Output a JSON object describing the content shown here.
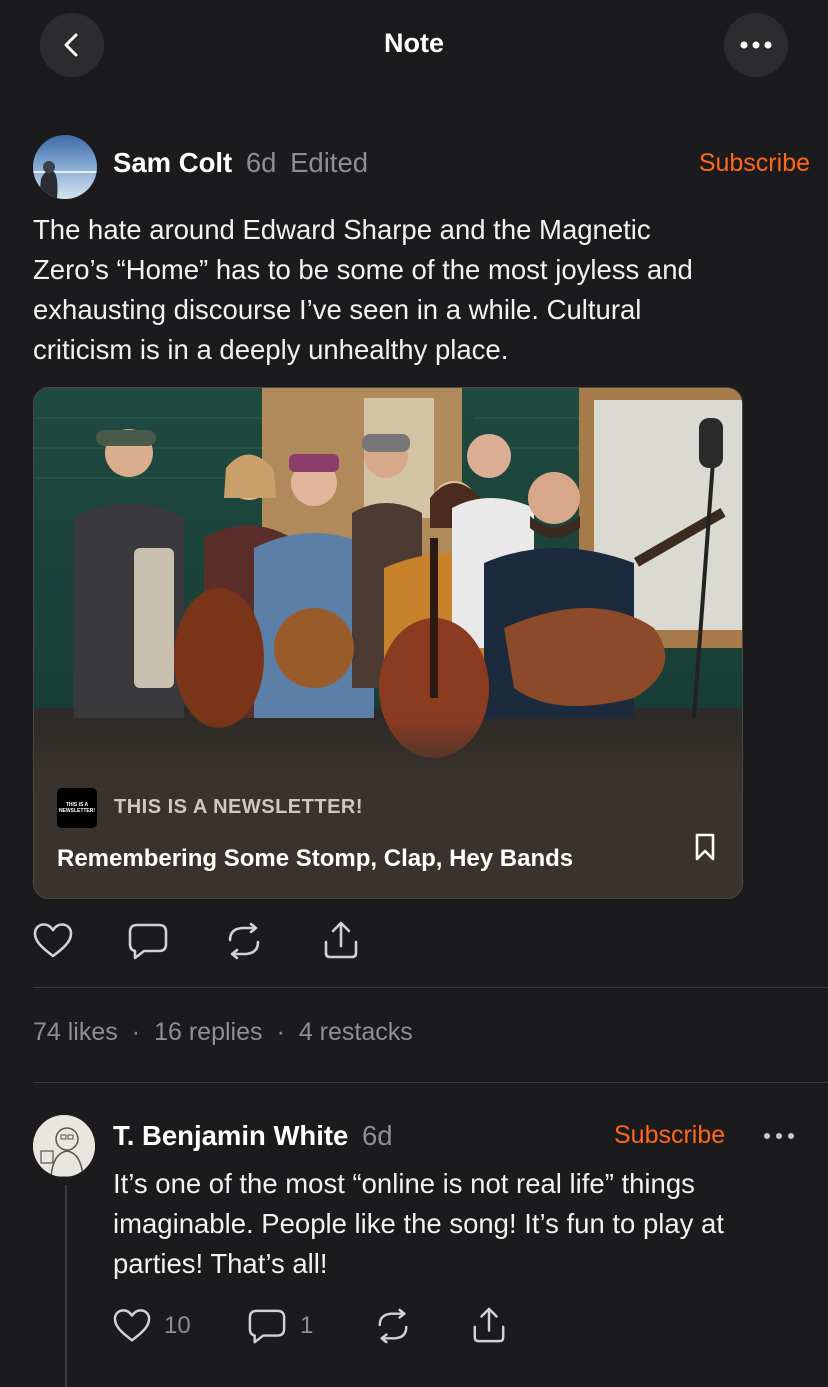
{
  "header": {
    "title": "Note"
  },
  "post": {
    "author": "Sam Colt",
    "age": "6d",
    "edited": "Edited",
    "subscribe": "Subscribe",
    "body_lines": [
      "The hate around Edward Sharpe and the Magnetic",
      "Zero’s “Home” has to be some of the most joyless and",
      "exhausting discourse I’ve seen in a while. Cultural",
      "criticism is in a deeply unhealthy place."
    ],
    "card": {
      "publication_logo_text": "THIS IS A NEWSLETTER!",
      "publication": "THIS IS A NEWSLETTER!",
      "title": "Remembering Some Stomp, Clap, Hey Bands"
    },
    "stats": {
      "likes": "74 likes",
      "replies": "16 replies",
      "restacks": "4 restacks"
    }
  },
  "reply": {
    "author": "T. Benjamin White",
    "age": "6d",
    "subscribe": "Subscribe",
    "body_lines": [
      "It’s one of the most “online is not real life” things",
      "imaginable. People like the song! It’s fun to play at",
      "parties! That’s all!"
    ],
    "like_count": "10",
    "comment_count": "1"
  },
  "colors": {
    "accent": "#ff6719",
    "background": "#1b1b1d",
    "muted": "#8e8e93"
  },
  "icons": [
    "back-arrow-icon",
    "more-icon",
    "heart-icon",
    "comment-icon",
    "restack-icon",
    "share-icon",
    "bookmark-icon"
  ]
}
